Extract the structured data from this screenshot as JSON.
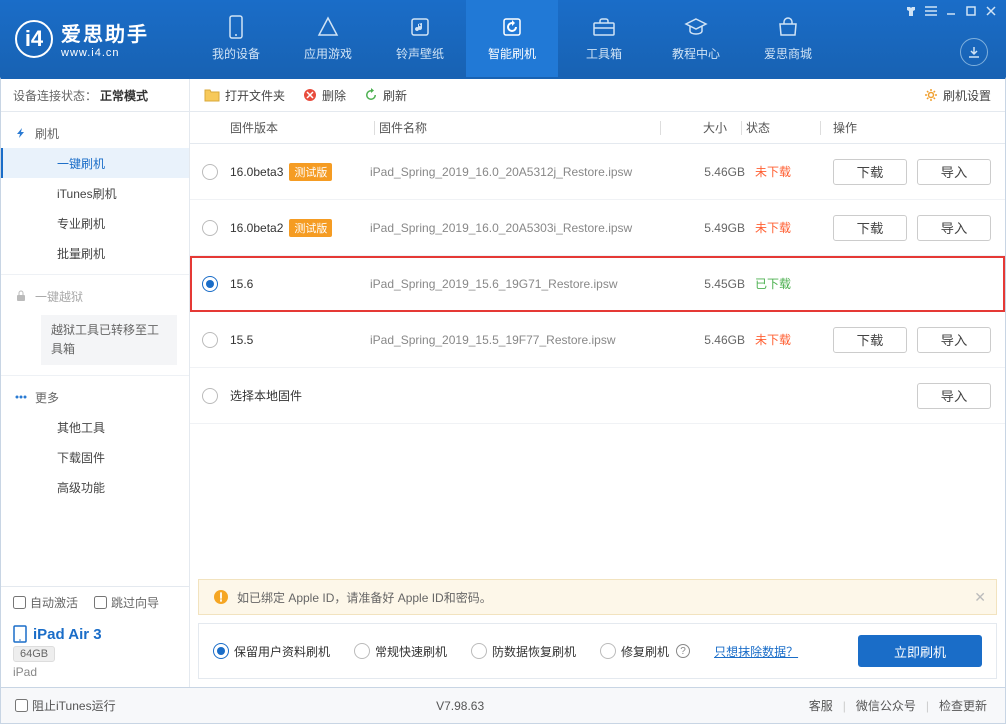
{
  "logo": {
    "title": "爱思助手",
    "url": "www.i4.cn"
  },
  "nav": [
    "我的设备",
    "应用游戏",
    "铃声壁纸",
    "智能刷机",
    "工具箱",
    "教程中心",
    "爱思商城"
  ],
  "status": {
    "label": "设备连接状态：",
    "value": "正常模式"
  },
  "sidebar": {
    "flash_head": "刷机",
    "flash_items": [
      "一键刷机",
      "iTunes刷机",
      "专业刷机",
      "批量刷机"
    ],
    "jb_head": "一键越狱",
    "jb_note": "越狱工具已转移至工具箱",
    "more_head": "更多",
    "more_items": [
      "其他工具",
      "下载固件",
      "高级功能"
    ]
  },
  "checks": {
    "auto": "自动激活",
    "skip": "跳过向导"
  },
  "device": {
    "name": "iPad Air 3",
    "storage": "64GB",
    "type": "iPad"
  },
  "toolbar": {
    "open": "打开文件夹",
    "del": "删除",
    "refresh": "刷新",
    "settings": "刷机设置"
  },
  "columns": {
    "ver": "固件版本",
    "name": "固件名称",
    "size": "大小",
    "status": "状态",
    "ops": "操作"
  },
  "rows": [
    {
      "ver": "16.0beta3",
      "beta": "测试版",
      "name": "iPad_Spring_2019_16.0_20A5312j_Restore.ipsw",
      "size": "5.46GB",
      "status": "未下载",
      "downloaded": false,
      "selected": false
    },
    {
      "ver": "16.0beta2",
      "beta": "测试版",
      "name": "iPad_Spring_2019_16.0_20A5303i_Restore.ipsw",
      "size": "5.49GB",
      "status": "未下载",
      "downloaded": false,
      "selected": false
    },
    {
      "ver": "15.6",
      "beta": "",
      "name": "iPad_Spring_2019_15.6_19G71_Restore.ipsw",
      "size": "5.45GB",
      "status": "已下载",
      "downloaded": true,
      "selected": true
    },
    {
      "ver": "15.5",
      "beta": "",
      "name": "iPad_Spring_2019_15.5_19F77_Restore.ipsw",
      "size": "5.46GB",
      "status": "未下载",
      "downloaded": false,
      "selected": false
    }
  ],
  "local_row": "选择本地固件",
  "btn": {
    "download": "下载",
    "import": "导入"
  },
  "notice": "如已绑定 Apple ID，请准备好 Apple ID和密码。",
  "actions": {
    "keep": "保留用户资料刷机",
    "normal": "常规快速刷机",
    "anti": "防数据恢复刷机",
    "repair": "修复刷机",
    "wipe": "只想抹除数据？",
    "go": "立即刷机"
  },
  "footer": {
    "block": "阻止iTunes运行",
    "version": "V7.98.63",
    "links": [
      "客服",
      "微信公众号",
      "检查更新"
    ]
  }
}
